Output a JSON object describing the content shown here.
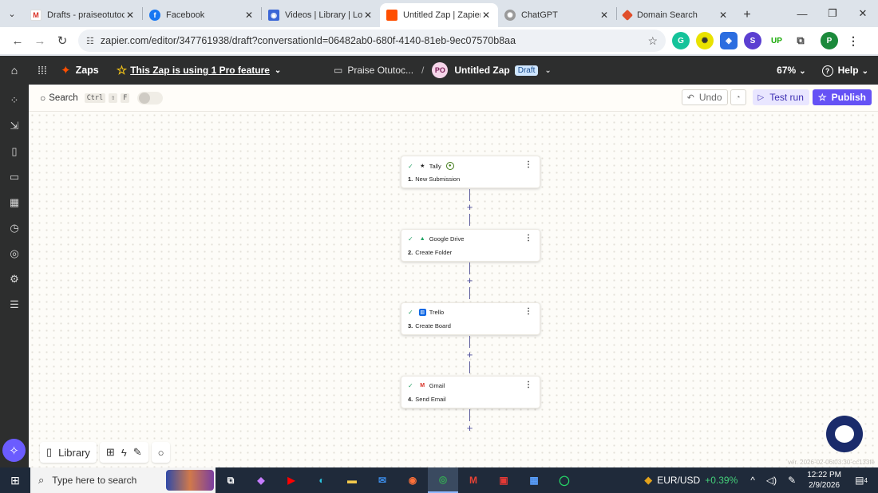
{
  "browser": {
    "tabs": [
      {
        "title": "Drafts - praiseotutoc",
        "icon": "gmail-icon",
        "active": false
      },
      {
        "title": "Facebook",
        "icon": "facebook-icon",
        "active": false
      },
      {
        "title": "Videos | Library | Loo",
        "icon": "loom-icon",
        "active": false
      },
      {
        "title": "Untitled Zap | Zapier",
        "icon": "zapier-icon",
        "active": true
      },
      {
        "title": "ChatGPT",
        "icon": "chatgpt-icon",
        "active": false
      },
      {
        "title": "Domain Search",
        "icon": "domain-search-icon",
        "active": false
      }
    ],
    "url": "zapier.com/editor/347761938/draft?conversationId=06482ab0-680f-4140-81eb-9ec07570b8aa",
    "profile_initial": "P"
  },
  "zapier_header": {
    "brand": "Zaps",
    "pro_notice": "This Zap is using 1 Pro feature",
    "folder": "Praise Otutoc...",
    "owner_initials": "PO",
    "zap_name": "Untitled Zap",
    "status_badge": "Draft",
    "zoom": "67%",
    "help": "Help"
  },
  "toolbar": {
    "search_label": "Search",
    "shortcut_keys": [
      "Ctrl",
      "⇧",
      "F"
    ],
    "undo_label": "Undo",
    "test_run_label": "Test run",
    "publish_label": "Publish"
  },
  "steps": [
    {
      "number": "1.",
      "app": "Tally",
      "action": "New Submission",
      "premium": true
    },
    {
      "number": "2.",
      "app": "Google Drive",
      "action": "Create Folder",
      "premium": false
    },
    {
      "number": "3.",
      "app": "Trello",
      "action": "Create Board",
      "premium": false
    },
    {
      "number": "4.",
      "app": "Gmail",
      "action": "Send Email",
      "premium": false
    }
  ],
  "bottom_tools": {
    "library_label": "Library"
  },
  "version": "ver. 2026-02-06t03:30-cc133fe",
  "taskbar": {
    "search_placeholder": "Type here to search",
    "fx_pair": "EUR/USD",
    "fx_change": "+0.39%",
    "time": "12:22 PM",
    "date": "2/9/2026",
    "notification_count": "4"
  },
  "colors": {
    "zapier_orange": "#ff4f00",
    "publish_purple": "#6552f5",
    "header_dark": "#2d2e2e",
    "success_green": "#2ea36b"
  }
}
